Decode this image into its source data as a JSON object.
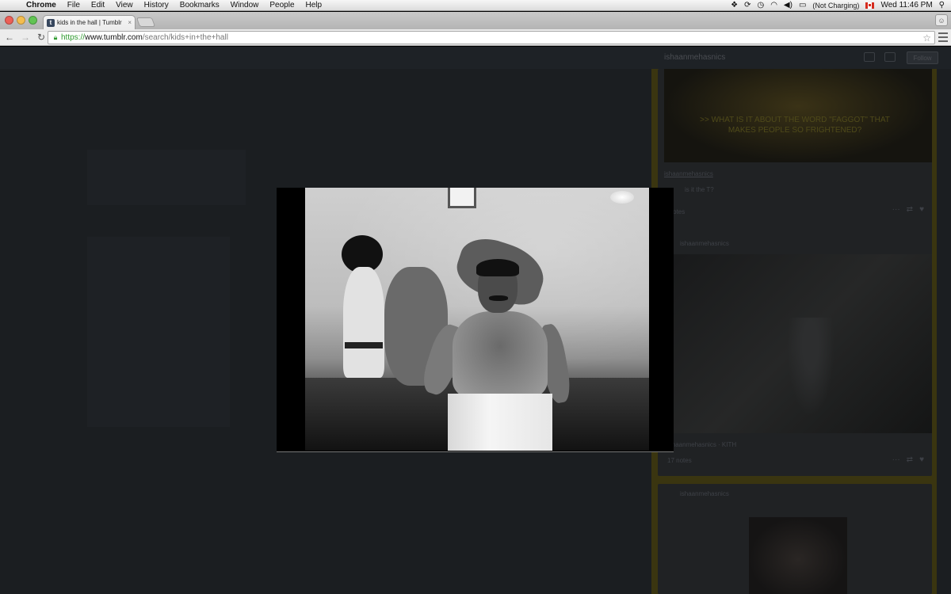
{
  "menubar": {
    "app": "Chrome",
    "items": [
      "File",
      "Edit",
      "View",
      "History",
      "Bookmarks",
      "Window",
      "People",
      "Help"
    ],
    "battery_label": "(Not Charging)",
    "clock": "Wed 11:46 PM"
  },
  "tab": {
    "favicon_letter": "t",
    "title": "kids in the hall | Tumblr",
    "close": "×"
  },
  "omnibox": {
    "scheme": "https://",
    "host": "www.tumblr.com",
    "path": "/search/kids+in+the+hall"
  },
  "page": {
    "blog_name": "ishaanmehasnics",
    "follow_label": "Follow",
    "posts": [
      {
        "overlay_text": ">> WHAT IS IT ABOUT THE WORD \"FAGGOT\" THAT MAKES PEOPLE SO FRIGHTENED?",
        "author": "ishaanmehasnics",
        "caption": "is it the T?",
        "notes": "2 notes"
      },
      {
        "head": "ishaanmehasnics",
        "caption": "ishaanmehasnics · KITH",
        "notes": "17 notes"
      },
      {
        "head": "ishaanmehasnics"
      }
    ]
  },
  "colors": {
    "tumblr_navy": "#36465d",
    "sidebar_yellow_dimmed": "#3a3510",
    "secure_green": "#2e9a2e"
  }
}
